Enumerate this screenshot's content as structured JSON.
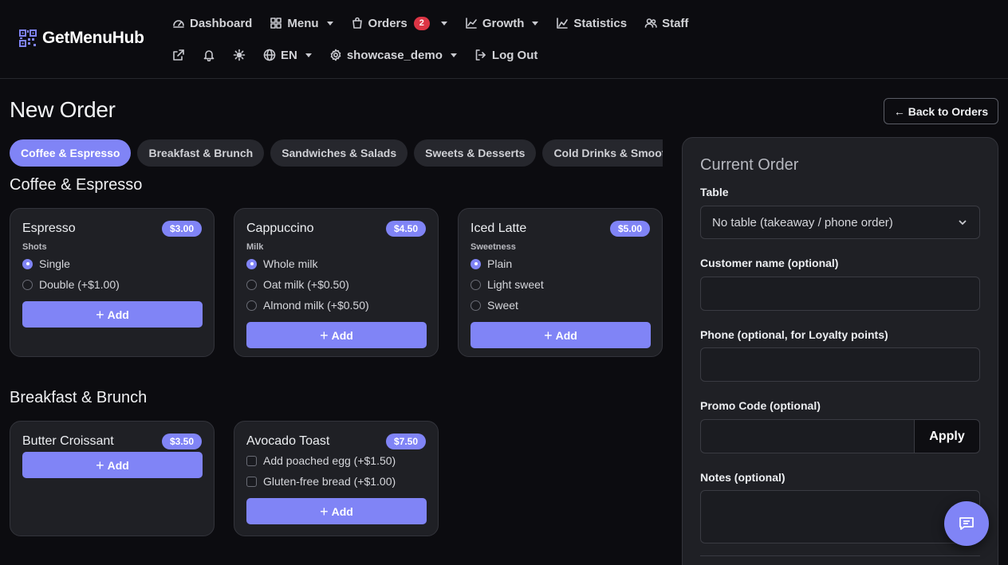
{
  "brand": {
    "name": "GetMenuHub"
  },
  "nav": {
    "dashboard": "Dashboard",
    "menu": "Menu",
    "orders": "Orders",
    "orders_badge": "2",
    "growth": "Growth",
    "statistics": "Statistics",
    "staff": "Staff",
    "language": "EN",
    "account": "showcase_demo",
    "logout": "Log Out"
  },
  "page": {
    "title": "New Order",
    "back_label": "← Back to Orders"
  },
  "tabs": [
    {
      "label": "Coffee & Espresso",
      "active": true
    },
    {
      "label": "Breakfast & Brunch"
    },
    {
      "label": "Sandwiches & Salads"
    },
    {
      "label": "Sweets & Desserts"
    },
    {
      "label": "Cold Drinks & Smoothies"
    }
  ],
  "sections": [
    {
      "title": "Coffee & Espresso",
      "items": [
        {
          "name": "Espresso",
          "price": "$3.00",
          "option_group": "Shots",
          "options": [
            "Single",
            "Double (+$1.00)"
          ]
        },
        {
          "name": "Cappuccino",
          "price": "$4.50",
          "option_group": "Milk",
          "options": [
            "Whole milk",
            "Oat milk (+$0.50)",
            "Almond milk (+$0.50)"
          ]
        },
        {
          "name": "Iced Latte",
          "price": "$5.00",
          "option_group": "Sweetness",
          "options": [
            "Plain",
            "Light sweet",
            "Sweet"
          ]
        }
      ]
    },
    {
      "title": "Breakfast & Brunch",
      "items": [
        {
          "name": "Butter Croissant",
          "price": "$3.50"
        },
        {
          "name": "Avocado Toast",
          "price": "$7.50",
          "options": [
            "Add poached egg (+$1.50)",
            "Gluten-free bread (+$1.00)"
          ]
        }
      ]
    }
  ],
  "add_label": "Add",
  "order": {
    "title": "Current Order",
    "table_label": "Table",
    "table_value": "No table (takeaway / phone order)",
    "customer_label": "Customer name (optional)",
    "customer_value": "",
    "phone_label": "Phone (optional, for Loyalty points)",
    "phone_value": "",
    "promo_label": "Promo Code (optional)",
    "promo_value": "",
    "apply_label": "Apply",
    "notes_label": "Notes (optional)",
    "notes_value": ""
  },
  "colors": {
    "accent": "#8084f6",
    "badge": "#dc3545",
    "background": "#0c0c10",
    "card": "#1f2025"
  }
}
